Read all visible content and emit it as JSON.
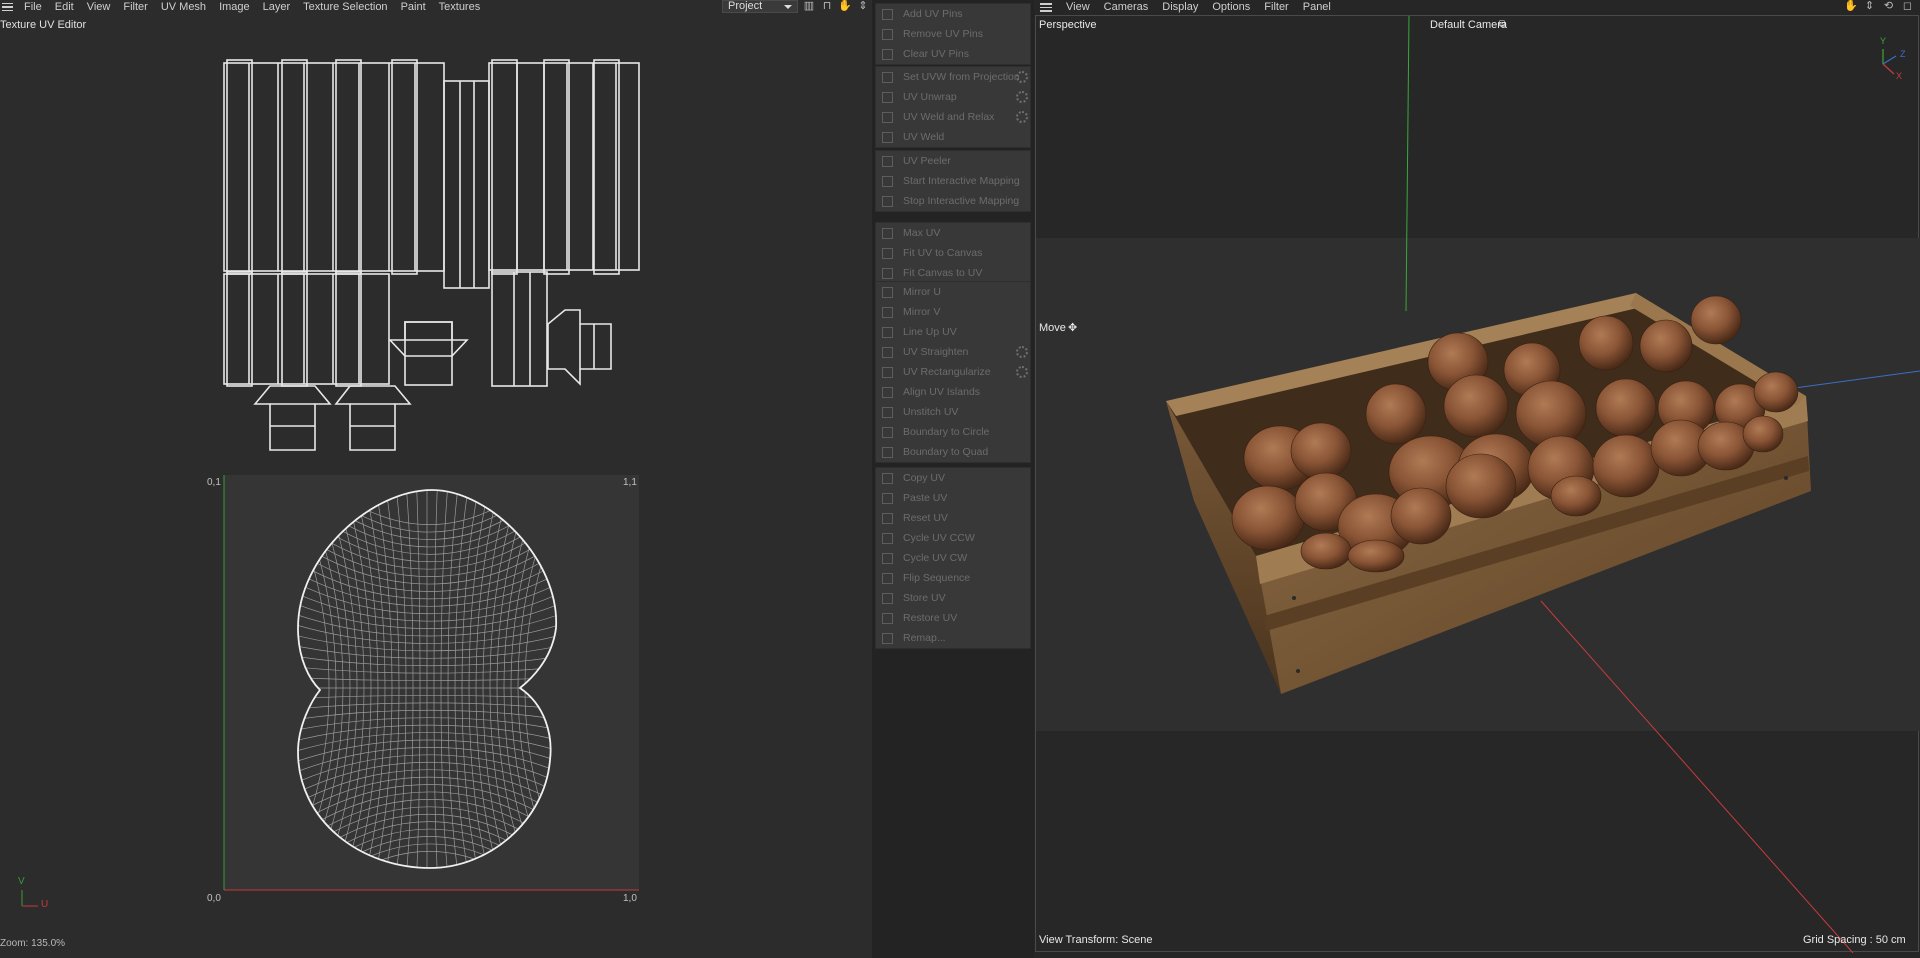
{
  "uv_editor": {
    "menu": [
      "File",
      "Edit",
      "View",
      "Filter",
      "UV Mesh",
      "Image",
      "Layer",
      "Texture Selection",
      "Paint",
      "Textures"
    ],
    "title": "Texture UV Editor",
    "project_select": "Project",
    "corner_labels": {
      "top_left": "0,1",
      "top_right": "1,1",
      "bottom_left": "0,0",
      "bottom_right": "1,0"
    },
    "axis_labels": {
      "v": "V",
      "u": "U"
    },
    "zoom": "Zoom: 135.0%",
    "colors": {
      "panel_bg": "#2c2c2c",
      "canvas_bg": "#353535",
      "uv_lines": "#e8e8e8",
      "u_axis": "#c43a3a",
      "v_axis": "#3a9a3a"
    }
  },
  "palette": {
    "groups": [
      [
        {
          "label": "Add UV Pins",
          "icon": "pin-icon"
        },
        {
          "label": "Remove UV Pins",
          "icon": "pin-remove-icon"
        },
        {
          "label": "Clear UV Pins",
          "icon": "x-icon"
        }
      ],
      [
        {
          "label": "Set UVW from Projection",
          "icon": "projection-icon",
          "gear": true
        },
        {
          "label": "UV Unwrap",
          "icon": "unwrap-icon",
          "gear": true
        },
        {
          "label": "UV Weld and Relax",
          "icon": "weld-relax-icon",
          "gear": true
        },
        {
          "label": "UV Weld",
          "icon": "weld-icon"
        }
      ],
      [
        {
          "label": "UV Peeler",
          "icon": "peeler-icon"
        },
        {
          "label": "Start Interactive Mapping",
          "icon": "play-icon"
        },
        {
          "label": "Stop Interactive Mapping",
          "icon": "stop-icon"
        }
      ],
      [
        {
          "label": "Max UV",
          "icon": "max-uv-icon"
        },
        {
          "label": "Fit UV to Canvas",
          "icon": "fit-uv-icon"
        },
        {
          "label": "Fit Canvas to UV",
          "icon": "fit-canvas-icon"
        }
      ],
      [
        {
          "label": "Mirror U",
          "icon": "mirror-u-icon"
        },
        {
          "label": "Mirror V",
          "icon": "mirror-v-icon"
        },
        {
          "label": "Line Up UV",
          "icon": "line-up-icon"
        },
        {
          "label": "UV Straighten",
          "icon": "straighten-icon",
          "gear": true
        },
        {
          "label": "UV Rectangularize",
          "icon": "rectangularize-icon",
          "gear": true
        },
        {
          "label": "Align UV Islands",
          "icon": "align-icon"
        },
        {
          "label": "Unstitch UV",
          "icon": "unstitch-icon"
        },
        {
          "label": "Boundary to Circle",
          "icon": "circle-icon"
        },
        {
          "label": "Boundary to Quad",
          "icon": "quad-icon"
        }
      ],
      [
        {
          "label": "Copy UV",
          "icon": "copy-icon"
        },
        {
          "label": "Paste UV",
          "icon": "paste-icon"
        },
        {
          "label": "Reset UV",
          "icon": "reset-icon"
        },
        {
          "label": "Cycle UV CCW",
          "icon": "cycle-ccw-icon"
        },
        {
          "label": "Cycle UV CW",
          "icon": "cycle-cw-icon"
        },
        {
          "label": "Flip Sequence",
          "icon": "flip-icon"
        },
        {
          "label": "Store UV",
          "icon": "store-icon"
        },
        {
          "label": "Restore UV",
          "icon": "restore-icon"
        },
        {
          "label": "Remap...",
          "icon": "remap-icon"
        }
      ]
    ]
  },
  "viewport": {
    "menu": [
      "View",
      "Cameras",
      "Display",
      "Options",
      "Filter",
      "Panel"
    ],
    "projection": "Perspective",
    "camera": "Default Camera",
    "tool": "Move",
    "view_transform": "View Transform: Scene",
    "grid_spacing": "Grid Spacing : 50 cm",
    "axis_gizmo": {
      "y": "Y",
      "z": "Z",
      "x": "X"
    },
    "colors": {
      "y_axis": "#3aa83a",
      "x_axis": "#c63c3c",
      "z_axis": "#3c6ec6",
      "wood": "#7a5a38",
      "coconut": "#8a5536"
    }
  }
}
